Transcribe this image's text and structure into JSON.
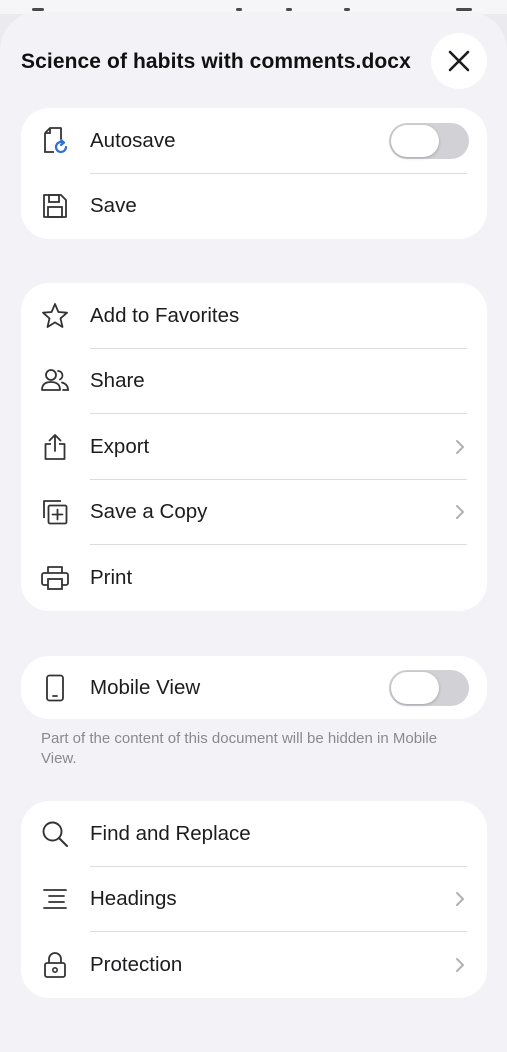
{
  "sheet": {
    "title": "Science of habits with comments.docx"
  },
  "close_icon": "close-icon",
  "groups": {
    "file": [
      {
        "label": "Autosave",
        "icon": "autosave-icon",
        "control": "toggle",
        "on": false
      },
      {
        "label": "Save",
        "icon": "save-icon",
        "control": "none"
      }
    ],
    "actions": [
      {
        "label": "Add to Favorites",
        "icon": "star-icon",
        "control": "none"
      },
      {
        "label": "Share",
        "icon": "people-icon",
        "control": "none"
      },
      {
        "label": "Export",
        "icon": "share-out-icon",
        "control": "chevron"
      },
      {
        "label": "Save a Copy",
        "icon": "copy-add-icon",
        "control": "chevron"
      },
      {
        "label": "Print",
        "icon": "printer-icon",
        "control": "none"
      }
    ],
    "view": [
      {
        "label": "Mobile View",
        "icon": "phone-icon",
        "control": "toggle",
        "on": false
      }
    ],
    "view_note": "Part of the content of this document will be hidden in Mobile View.",
    "tools": [
      {
        "label": "Find and Replace",
        "icon": "search-icon",
        "control": "none"
      },
      {
        "label": "Headings",
        "icon": "headings-icon",
        "control": "chevron"
      },
      {
        "label": "Protection",
        "icon": "lock-icon",
        "control": "chevron"
      }
    ]
  },
  "colors": {
    "background": "#f2f2f7",
    "card": "#ffffff",
    "toggle_off": "#d1d1d6",
    "chevron": "#b0b0b5",
    "secondary_text": "#8a8a8e"
  }
}
